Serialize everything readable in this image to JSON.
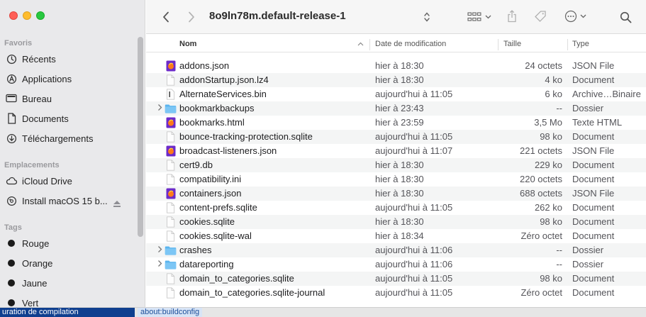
{
  "window": {
    "title": "8o9ln78m.default-release-1"
  },
  "sidebar": {
    "favorites_header": "Favoris",
    "favorites": [
      {
        "label": "Récents",
        "icon": "clock-icon"
      },
      {
        "label": "Applications",
        "icon": "applications-icon"
      },
      {
        "label": "Bureau",
        "icon": "desktop-icon"
      },
      {
        "label": "Documents",
        "icon": "document-icon"
      },
      {
        "label": "Téléchargements",
        "icon": "download-icon"
      }
    ],
    "locations_header": "Emplacements",
    "locations": [
      {
        "label": "iCloud Drive",
        "icon": "cloud-icon"
      },
      {
        "label": "Install macOS 15 b...",
        "icon": "disk-icon"
      }
    ],
    "tags_header": "Tags",
    "tags": [
      {
        "label": "Rouge",
        "color": "#1b1b1b"
      },
      {
        "label": "Orange",
        "color": "#1b1b1b"
      },
      {
        "label": "Jaune",
        "color": "#1b1b1b"
      },
      {
        "label": "Vert",
        "color": "#1b1b1b"
      }
    ]
  },
  "columns": {
    "name": "Nom",
    "date": "Date de modification",
    "size": "Taille",
    "kind": "Type"
  },
  "files": [
    {
      "name": "addons.json",
      "date": "hier à 18:30",
      "size": "24 octets",
      "kind": "JSON File",
      "icon": "json-file-icon"
    },
    {
      "name": "addonStartup.json.lz4",
      "date": "hier à 18:30",
      "size": "4 ko",
      "kind": "Document",
      "icon": "file-icon"
    },
    {
      "name": "AlternateServices.bin",
      "date": "aujourd'hui à 11:05",
      "size": "6 ko",
      "kind": "Archive…Binaire",
      "icon": "binary-file-icon"
    },
    {
      "name": "bookmarkbackups",
      "date": "hier à 23:43",
      "size": "--",
      "kind": "Dossier",
      "icon": "folder-icon",
      "folder": true
    },
    {
      "name": "bookmarks.html",
      "date": "hier à 23:59",
      "size": "3,5 Mo",
      "kind": "Texte HTML",
      "icon": "html-file-icon"
    },
    {
      "name": "bounce-tracking-protection.sqlite",
      "date": "aujourd'hui à 11:05",
      "size": "98 ko",
      "kind": "Document",
      "icon": "file-icon"
    },
    {
      "name": "broadcast-listeners.json",
      "date": "aujourd'hui à 11:07",
      "size": "221 octets",
      "kind": "JSON File",
      "icon": "json-file-icon"
    },
    {
      "name": "cert9.db",
      "date": "hier à 18:30",
      "size": "229 ko",
      "kind": "Document",
      "icon": "file-icon"
    },
    {
      "name": "compatibility.ini",
      "date": "hier à 18:30",
      "size": "220 octets",
      "kind": "Document",
      "icon": "file-icon"
    },
    {
      "name": "containers.json",
      "date": "hier à 18:30",
      "size": "688 octets",
      "kind": "JSON File",
      "icon": "json-file-icon"
    },
    {
      "name": "content-prefs.sqlite",
      "date": "aujourd'hui à 11:05",
      "size": "262 ko",
      "kind": "Document",
      "icon": "file-icon"
    },
    {
      "name": "cookies.sqlite",
      "date": "hier à 18:30",
      "size": "98 ko",
      "kind": "Document",
      "icon": "file-icon"
    },
    {
      "name": "cookies.sqlite-wal",
      "date": "hier à 18:34",
      "size": "Zéro octet",
      "kind": "Document",
      "icon": "file-icon"
    },
    {
      "name": "crashes",
      "date": "aujourd'hui à 11:06",
      "size": "--",
      "kind": "Dossier",
      "icon": "folder-icon",
      "folder": true
    },
    {
      "name": "datareporting",
      "date": "aujourd'hui à 11:06",
      "size": "--",
      "kind": "Dossier",
      "icon": "folder-icon",
      "folder": true
    },
    {
      "name": "domain_to_categories.sqlite",
      "date": "aujourd'hui à 11:05",
      "size": "98 ko",
      "kind": "Document",
      "icon": "file-icon"
    },
    {
      "name": "domain_to_categories.sqlite-journal",
      "date": "aujourd'hui à 11:05",
      "size": "Zéro octet",
      "kind": "Document",
      "icon": "file-icon"
    }
  ],
  "bottom": {
    "left": "uration de compilation",
    "tab": "about:buildconfig"
  },
  "colors": {
    "folder": "#5ab4ee",
    "json_badge": "#6d2bc9",
    "json_fire": "#ff7a1a"
  }
}
